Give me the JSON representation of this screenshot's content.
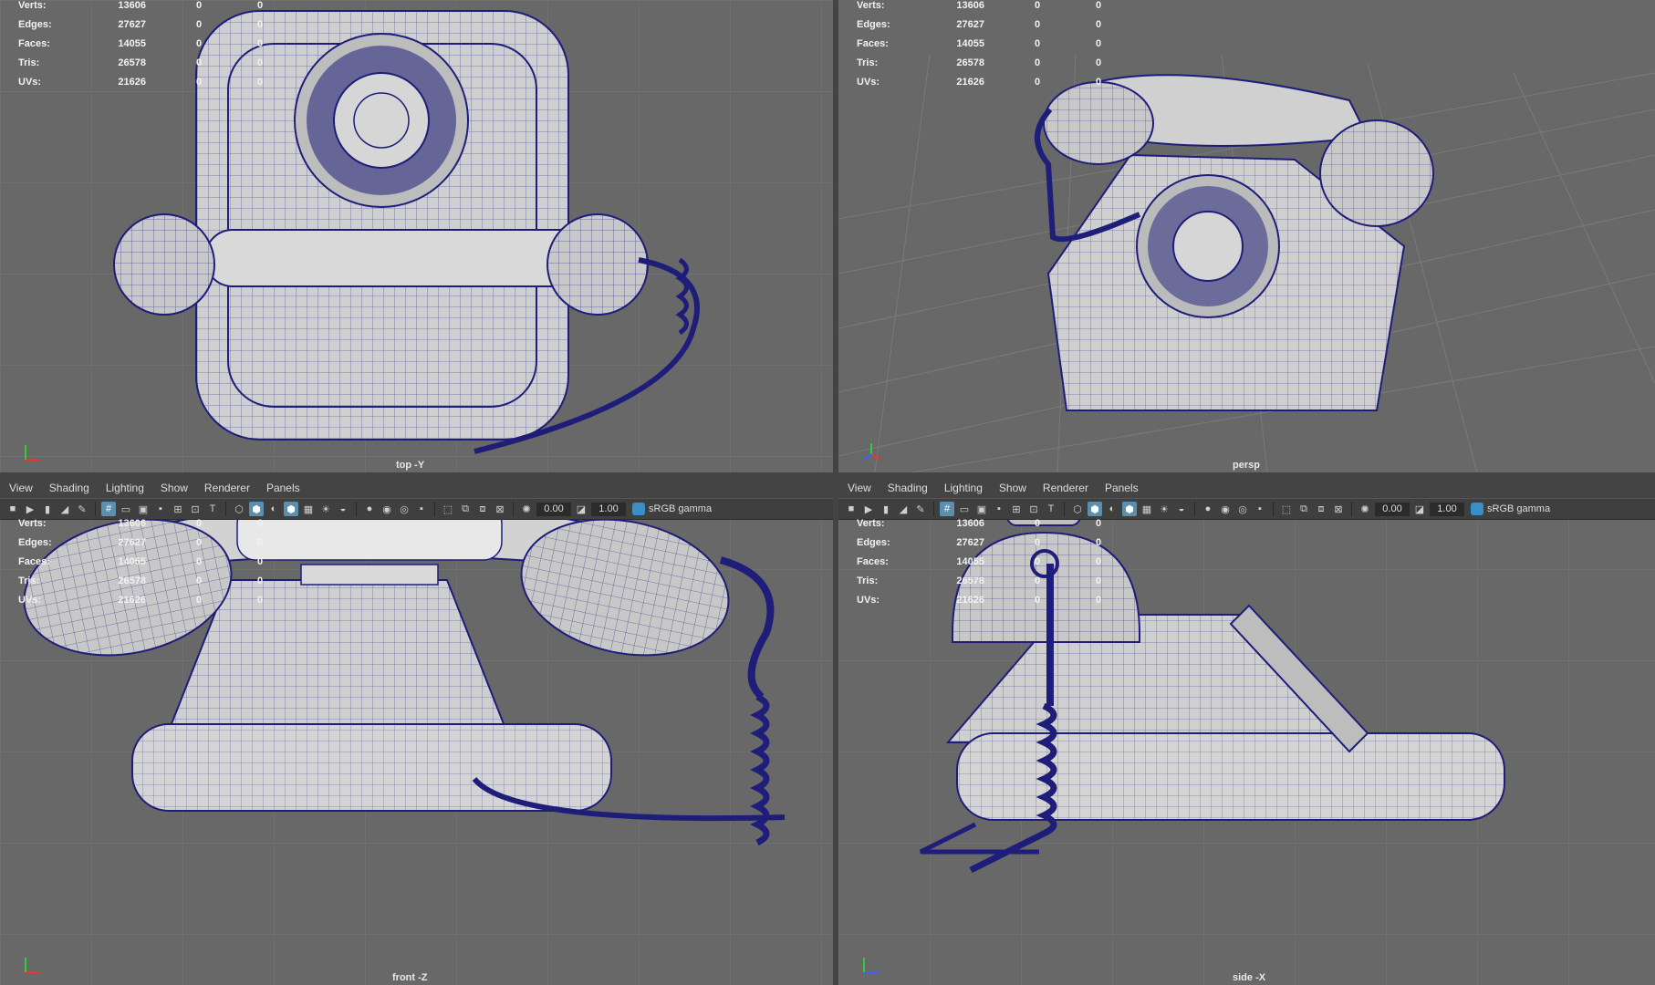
{
  "stats": {
    "verts": {
      "label": "Verts:",
      "v1": "13606",
      "v2": "0",
      "v3": "0"
    },
    "edges": {
      "label": "Edges:",
      "v1": "27627",
      "v2": "0",
      "v3": "0"
    },
    "faces": {
      "label": "Faces:",
      "v1": "14055",
      "v2": "0",
      "v3": "0"
    },
    "tris": {
      "label": "Tris:",
      "v1": "26578",
      "v2": "0",
      "v3": "0"
    },
    "uvs": {
      "label": "UVs:",
      "v1": "21626",
      "v2": "0",
      "v3": "0"
    }
  },
  "menus": [
    "View",
    "Shading",
    "Lighting",
    "Show",
    "Renderer",
    "Panels"
  ],
  "toolbar": {
    "exposure": "0.00",
    "gamma": "1.00",
    "color_space": "sRGB gamma"
  },
  "viewports": {
    "top": {
      "camera": "top -Y"
    },
    "persp": {
      "camera": "persp"
    },
    "front": {
      "camera": "front -Z"
    },
    "side": {
      "camera": "side -X"
    }
  },
  "colors": {
    "wire": "#1e1e7a",
    "surface": "#cfcfcf",
    "grid": "#777777",
    "background": "#686868"
  }
}
